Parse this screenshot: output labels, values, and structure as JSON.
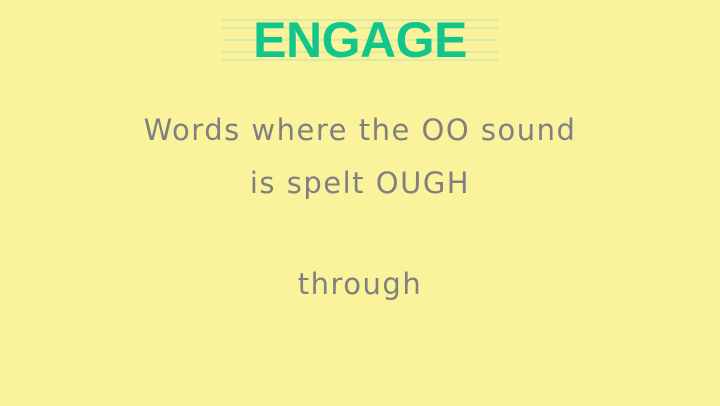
{
  "slide": {
    "heading": "ENGAGE",
    "subtitle_line1": "Words where the OO sound",
    "subtitle_line2": "is spelt OUGH",
    "example_word": "through"
  },
  "colors": {
    "background": "#fbf39b",
    "heading": "#12c58b",
    "text": "#808080",
    "guide_lines": "#b8e3b0"
  }
}
